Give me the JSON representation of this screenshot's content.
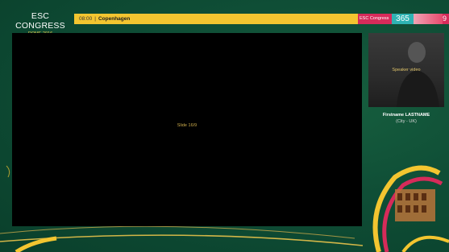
{
  "logo": {
    "title": "ESC CONGRESS",
    "subtitle": "ROME 2016"
  },
  "session_bar": {
    "time": "08:00",
    "separator": "|",
    "location": "Copenhagen"
  },
  "brand": {
    "label": "ESC Congress",
    "number": "365",
    "trailing_char": "9"
  },
  "slide": {
    "label": "Slide 16/9"
  },
  "speaker": {
    "video_label": "Speaker video",
    "name": "Firstname LASTNAME",
    "city": "(City - UK)"
  },
  "colors": {
    "background": "#0d4a33",
    "accent_yellow": "#f3c530",
    "brand_pink": "#d62b5a",
    "brand_teal": "#2fb3b3",
    "slide_background": "#000000"
  }
}
